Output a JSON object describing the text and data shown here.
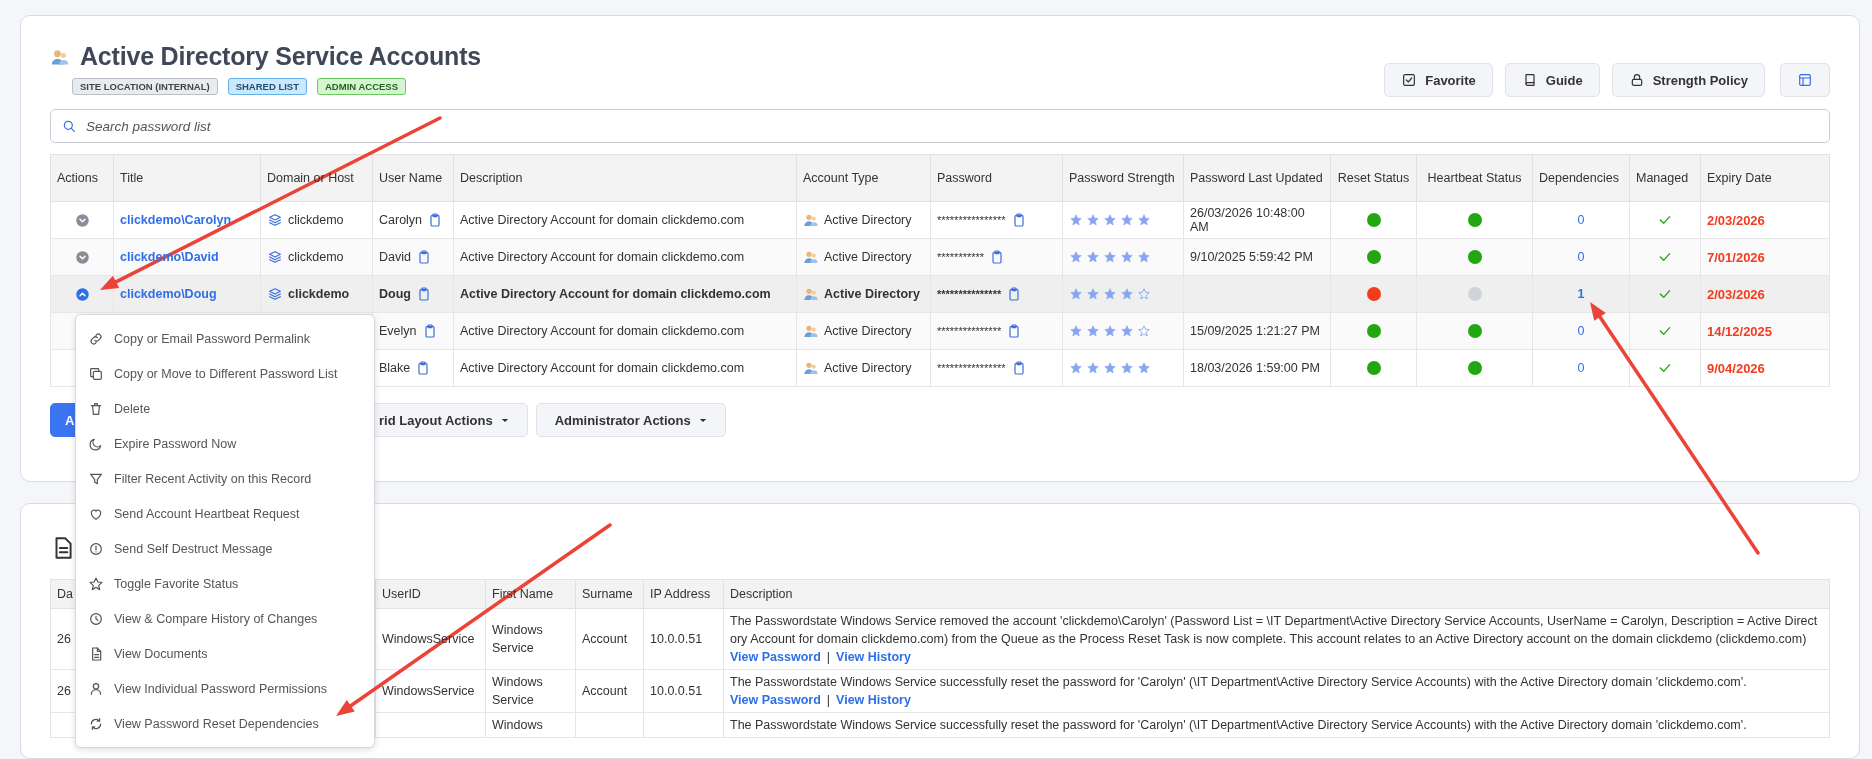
{
  "header": {
    "title": "Active Directory Service Accounts",
    "badges": [
      {
        "label": "SITE LOCATION (INTERNAL)",
        "color": "#e9ecef"
      },
      {
        "label": "SHARED LIST",
        "color": "#cce9fb"
      },
      {
        "label": "ADMIN ACCESS",
        "color": "#d5f5d0"
      }
    ]
  },
  "toolbar": [
    {
      "kind": "favorite",
      "label": "Favorite"
    },
    {
      "kind": "guide",
      "label": "Guide"
    },
    {
      "kind": "policy",
      "label": "Strength Policy"
    },
    {
      "kind": "layout"
    }
  ],
  "search": {
    "placeholder": "Search password list"
  },
  "table": {
    "columns": [
      "Actions",
      "Title",
      "Domain or Host",
      "User Name",
      "Description",
      "Account Type",
      "Password",
      "Password Strength",
      "Password Last Updated",
      "Reset Status",
      "Heartbeat Status",
      "Dependencies",
      "Managed",
      "Expiry Date"
    ],
    "rows": [
      {
        "selected": false,
        "expanded": false,
        "title": "clickdemo\\Carolyn",
        "domain": "clickdemo",
        "user_name": "Carolyn",
        "description": "Active Directory Account for domain clickdemo.com",
        "account_type": "Active Directory",
        "password": "****************",
        "stars": 5,
        "last_updated": "26/03/2026 10:48:00 AM",
        "reset_status": {
          "color": "#22a612"
        },
        "heartbeat_status": {
          "color": "#22a612"
        },
        "dependencies": "0",
        "managed": true,
        "expiry": "2/03/2026"
      },
      {
        "selected": false,
        "expanded": false,
        "title": "clickdemo\\David",
        "domain": "clickdemo",
        "user_name": "David",
        "description": "Active Directory Account for domain clickdemo.com",
        "account_type": "Active Directory",
        "password": "***********",
        "stars": 5,
        "last_updated": "9/10/2025 5:59:42 PM",
        "reset_status": {
          "color": "#22a612"
        },
        "heartbeat_status": {
          "color": "#22a612"
        },
        "dependencies": "0",
        "managed": true,
        "expiry": "7/01/2026"
      },
      {
        "selected": true,
        "expanded": true,
        "title": "clickdemo\\Doug",
        "domain": "clickdemo",
        "user_name": "Doug",
        "description": "Active Directory Account for domain clickdemo.com",
        "account_type": "Active Directory",
        "password": "***************",
        "stars": 4,
        "reset_status": {
          "color": "#f43c1c"
        },
        "heartbeat_status": {
          "color": "#d0d3dc"
        },
        "dependencies": "1",
        "managed": true,
        "expiry": "2/03/2026"
      },
      {
        "selected": false,
        "user_name": "Evelyn",
        "description": "Active Directory Account for domain clickdemo.com",
        "account_type": "Active Directory",
        "password": "***************",
        "stars": 4,
        "last_updated": "15/09/2025 1:21:27 PM",
        "reset_status": {
          "color": "#22a612"
        },
        "heartbeat_status": {
          "color": "#22a612"
        },
        "dependencies": "0",
        "managed": true,
        "expiry": "14/12/2025"
      },
      {
        "selected": false,
        "user_name": "Blake",
        "description": "Active Directory Account for domain clickdemo.com",
        "account_type": "Active Directory",
        "password": "****************",
        "stars": 5,
        "last_updated": "18/03/2026 1:59:00 PM",
        "reset_status": {
          "color": "#22a612"
        },
        "heartbeat_status": {
          "color": "#22a612"
        },
        "dependencies": "0",
        "managed": true,
        "expiry": "9/04/2026"
      }
    ]
  },
  "actions": [
    {
      "kind": "primary",
      "label": "A"
    },
    {
      "kind": "dropdown",
      "label": "rid Layout Actions"
    },
    {
      "kind": "dropdown",
      "label": "Administrator Actions"
    }
  ],
  "context_menu": {
    "items": [
      {
        "kind": "link",
        "label": "Copy or Email Password Permalink"
      },
      {
        "kind": "copy",
        "label": "Copy or Move to Different Password List"
      },
      {
        "kind": "delete",
        "label": "Delete"
      },
      {
        "kind": "expire",
        "label": "Expire Password Now"
      },
      {
        "kind": "filter",
        "label": "Filter Recent Activity on this Record"
      },
      {
        "kind": "heartbeat",
        "label": "Send Account Heartbeat Request"
      },
      {
        "kind": "destruct",
        "label": "Send Self Destruct Message"
      },
      {
        "kind": "favorite",
        "label": "Toggle Favorite Status"
      },
      {
        "kind": "history",
        "label": "View & Compare History of Changes"
      },
      {
        "kind": "documents",
        "label": "View Documents"
      },
      {
        "kind": "permissions",
        "label": "View Individual Password Permissions"
      },
      {
        "kind": "dependencies",
        "label": "View Password Reset Dependencies"
      }
    ]
  },
  "log": {
    "columns": [
      "Da",
      "UserID",
      "First Name",
      "Surname",
      "IP Address",
      "Description"
    ],
    "rows": [
      {
        "date": "26",
        "user_id": "WindowsService",
        "first_name": "Windows Service",
        "surname": "Account",
        "ip_address": "10.0.0.51",
        "description": "The Passwordstate Windows Service removed the account 'clickdemo\\Carolyn' (Password List = \\IT Department\\Active Directory Service Accounts, UserName = Carolyn, Description = Active Directory Account for domain clickdemo.com) from the Queue as the Process Reset Task is now complete. This account relates to an Active Directory account on the domain clickdemo (clickdemo.com)",
        "links": [
          "View Password",
          "View History"
        ],
        "separator": "|"
      },
      {
        "date": "26",
        "user_id": "WindowsService",
        "first_name": "Windows Service",
        "surname": "Account",
        "ip_address": "10.0.0.51",
        "description": "The Passwordstate Windows Service successfully reset the password for 'Carolyn' (\\IT Department\\Active Directory Service Accounts) with the Active Directory domain 'clickdemo.com'.",
        "links": [
          "View Password",
          "View History"
        ],
        "separator": "|"
      },
      {
        "first_name": "Windows",
        "description": "The Passwordstate Windows Service successfully reset the password for 'Carolyn' (\\IT Department\\Active Directory Service Accounts) with the Active Directory domain 'clickdemo.com'."
      }
    ]
  }
}
